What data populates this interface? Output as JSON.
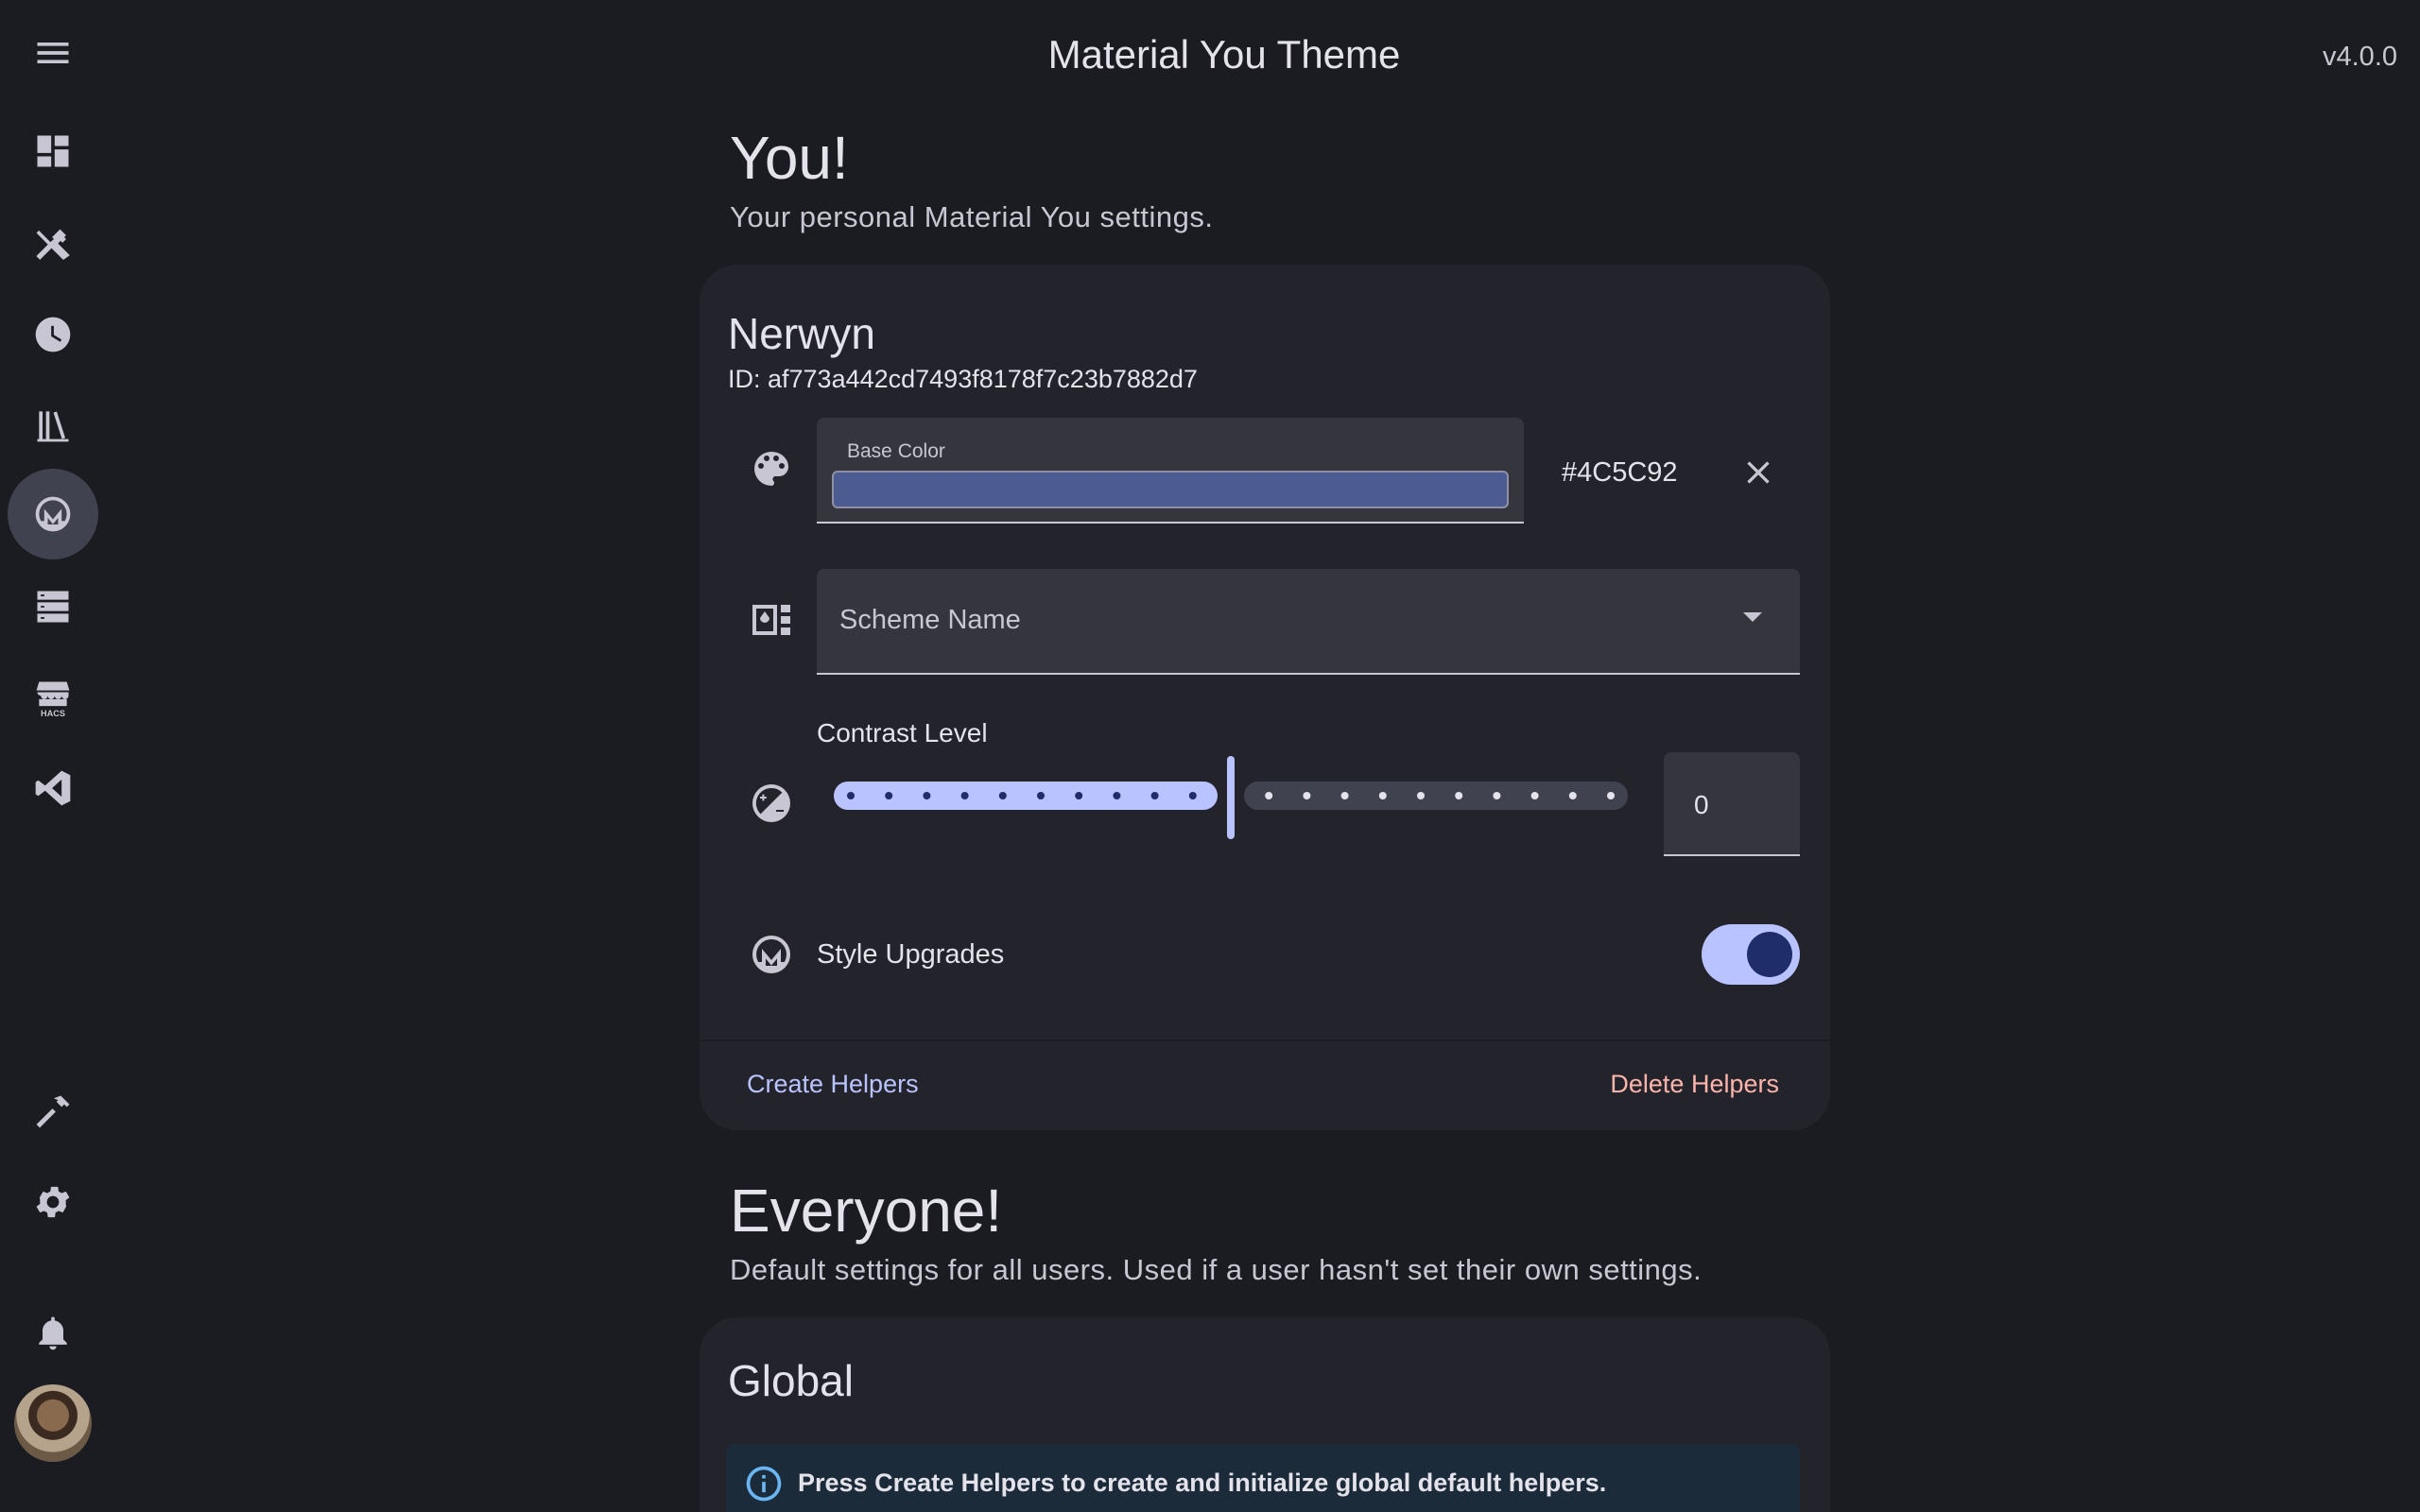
{
  "header": {
    "title": "Material You Theme",
    "version": "v4.0.0"
  },
  "sidebar": {
    "items": [
      {
        "icon": "dashboard-icon"
      },
      {
        "icon": "tools-icon"
      },
      {
        "icon": "history-icon"
      },
      {
        "icon": "library-icon"
      },
      {
        "icon": "material-you-icon",
        "active": true
      },
      {
        "icon": "server-icon"
      },
      {
        "icon": "hacs-store-icon",
        "label": "HACS"
      },
      {
        "icon": "vscode-icon"
      },
      {
        "icon": "hammer-icon"
      },
      {
        "icon": "gear-icon"
      },
      {
        "icon": "bell-icon"
      }
    ]
  },
  "you": {
    "title": "You!",
    "description": "Your personal Material You settings."
  },
  "user_card": {
    "name": "Nerwyn",
    "id": "ID: af773a442cd7493f8178f7c23b7882d7",
    "base_color": {
      "label": "Base Color",
      "hex": "#4C5C92",
      "swatch": "#4c5c92"
    },
    "scheme": {
      "label": "Scheme Name"
    },
    "contrast": {
      "label": "Contrast Level",
      "value": "0",
      "min": -1,
      "max": 1,
      "current": 0
    },
    "style_upgrades": {
      "label": "Style Upgrades",
      "enabled": true
    },
    "actions": {
      "create": "Create Helpers",
      "delete": "Delete Helpers"
    }
  },
  "everyone": {
    "title": "Everyone!",
    "description": "Default settings for all users. Used if a user hasn't set their own settings."
  },
  "global_card": {
    "title": "Global",
    "info": "Press Create Helpers to create and initialize global default helpers."
  },
  "colors": {
    "accent": "#b9c3ff",
    "danger": "#ffb4ab",
    "background": "#1b1c22",
    "card": "#23242b"
  }
}
